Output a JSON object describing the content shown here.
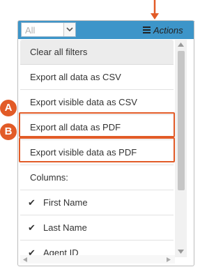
{
  "filter": {
    "value": "All"
  },
  "actions": {
    "label": "Actions",
    "icon": "hamburger-menu-icon"
  },
  "menu": {
    "clear_filters": "Clear all filters",
    "export_all_csv": "Export all data as CSV",
    "export_visible_csv": "Export visible data as CSV",
    "export_all_pdf": "Export all data as PDF",
    "export_visible_pdf": "Export visible data as PDF",
    "columns_heading": "Columns:",
    "columns": [
      {
        "label": "First Name",
        "checked": true
      },
      {
        "label": "Last Name",
        "checked": true
      },
      {
        "label": "Agent ID",
        "checked": true
      }
    ]
  },
  "callouts": {
    "a": "A",
    "b": "B"
  },
  "colors": {
    "header_blue": "#3d95c9",
    "highlight_orange": "#e25b27"
  }
}
